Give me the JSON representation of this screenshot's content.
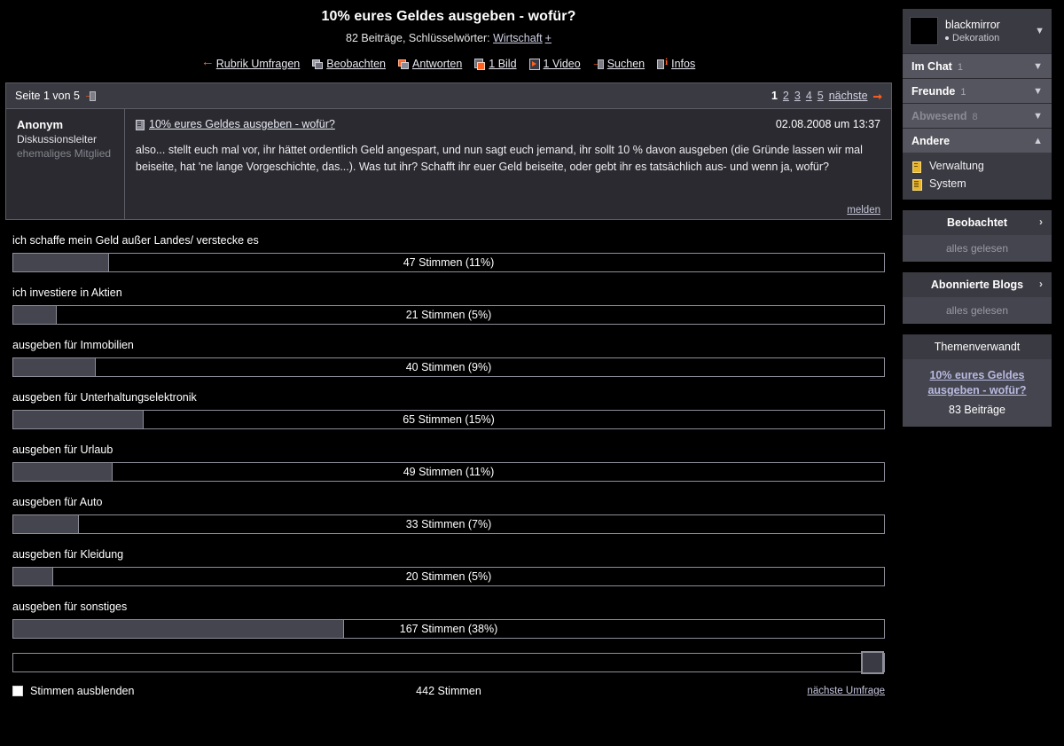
{
  "header": {
    "title": "10% eures Geldes ausgeben - wofür?",
    "meta_prefix": "82 Beiträge, Schlüsselwörter:",
    "keyword": "Wirtschaft",
    "keyword_plus": "+"
  },
  "nav": [
    {
      "label": "Rubrik Umfragen",
      "icon": "arrow-left-icon"
    },
    {
      "label": "Beobachten",
      "icon": "speech-bubbles-icon"
    },
    {
      "label": "Antworten",
      "icon": "speech-bubbles-orange-icon"
    },
    {
      "label": "1 Bild",
      "icon": "image-icon"
    },
    {
      "label": "1 Video",
      "icon": "video-icon"
    },
    {
      "label": "Suchen",
      "icon": "arrow-right-box-icon"
    },
    {
      "label": "Infos",
      "icon": "info-icon"
    }
  ],
  "pagination": {
    "page_label": "Seite 1 von 5",
    "pages": [
      "1",
      "2",
      "3",
      "4",
      "5"
    ],
    "current": "1",
    "next_label": "nächste"
  },
  "post": {
    "author": "Anonym",
    "role": "Diskussionsleiter",
    "status": "ehemaliges Mitglied",
    "title": "10% eures Geldes ausgeben - wofür?",
    "date": "02.08.2008 um 13:37",
    "text": "also... stellt euch mal vor, ihr hättet ordentlich Geld angespart, und nun sagt euch jemand, ihr sollt 10 % davon ausgeben (die Gründe lassen wir mal beiseite, hat 'ne lange Vorgeschichte, das...). Was tut ihr? Schafft ihr euer Geld beiseite, oder gebt ihr es tatsächlich aus- und wenn ja, wofür?",
    "report_label": "melden"
  },
  "chart_data": {
    "type": "bar",
    "title": "10% eures Geldes ausgeben - wofür?",
    "xlabel": "",
    "ylabel": "Stimmen",
    "total_label": "442 Stimmen",
    "total": 442,
    "categories": [
      "ich schaffe mein Geld außer Landes/ verstecke es",
      "ich investiere in Aktien",
      "ausgeben für Immobilien",
      "ausgeben für Unterhaltungselektronik",
      "ausgeben für Urlaub",
      "ausgeben für Auto",
      "ausgeben für Kleidung",
      "ausgeben für sonstiges"
    ],
    "values": [
      47,
      21,
      40,
      65,
      49,
      33,
      20,
      167
    ],
    "percents": [
      11,
      5,
      9,
      15,
      11,
      7,
      5,
      38
    ],
    "value_labels": [
      "47 Stimmen (11%)",
      "21 Stimmen (5%)",
      "40 Stimmen (9%)",
      "65 Stimmen (15%)",
      "49 Stimmen (11%)",
      "33 Stimmen (7%)",
      "20 Stimmen (5%)",
      "167 Stimmen (38%)"
    ],
    "bar_fill_color": "#45454f",
    "bar_border_color": "#8e8e99",
    "grid": false,
    "legend": "none"
  },
  "poll_footer": {
    "hide_votes_label": "Stimmen ausblenden",
    "total_label": "442 Stimmen",
    "next_poll_label": "nächste Umfrage"
  },
  "sidebar": {
    "user": {
      "name": "blackmirror",
      "status": "Dekoration"
    },
    "groups": [
      {
        "name": "Im Chat",
        "count": "1",
        "dim": false,
        "expanded": false
      },
      {
        "name": "Freunde",
        "count": "1",
        "dim": false,
        "expanded": false
      },
      {
        "name": "Abwesend",
        "count": "8",
        "dim": true,
        "expanded": false
      },
      {
        "name": "Andere",
        "count": "",
        "dim": false,
        "expanded": true
      }
    ],
    "other_items": [
      {
        "label": "Verwaltung",
        "icon": "yellow-user-icon"
      },
      {
        "label": "System",
        "icon": "yellow-doc-icon"
      }
    ],
    "panels": [
      {
        "title": "Beobachtet",
        "body": "alles gelesen",
        "arrow": "›"
      },
      {
        "title": "Abonnierte Blogs",
        "body": "alles gelesen",
        "arrow": "›"
      }
    ],
    "related": {
      "title": "Themenverwandt",
      "link": "10% eures Geldes ausgeben - wofür?",
      "count": "83 Beiträge"
    }
  }
}
